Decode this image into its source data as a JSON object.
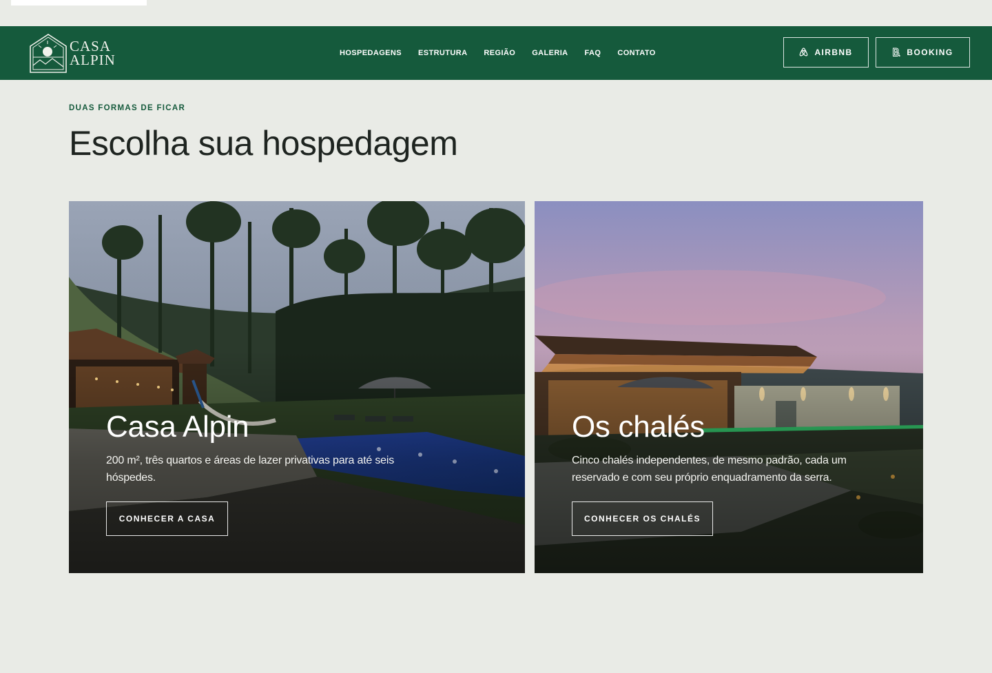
{
  "brand": {
    "name_line1": "CASA",
    "name_line2": "ALPIN",
    "primary_color": "#155a3c",
    "background_color": "#e9ebe6",
    "logo_icon": "mountain-house-logo-icon"
  },
  "nav": {
    "items": [
      {
        "label": "HOSPEDAGENS"
      },
      {
        "label": "ESTRUTURA"
      },
      {
        "label": "REGIÃO"
      },
      {
        "label": "GALERIA"
      },
      {
        "label": "FAQ"
      },
      {
        "label": "CONTATO"
      }
    ]
  },
  "booking": {
    "airbnb": {
      "label": "AIRBNB",
      "icon": "airbnb-icon"
    },
    "booking": {
      "label": "BOOKING",
      "icon": "booking-icon"
    }
  },
  "section": {
    "eyebrow": "DUAS FORMAS DE FICAR",
    "title": "Escolha sua hospedagem"
  },
  "cards": [
    {
      "title": "Casa Alpin",
      "description": "200 m², três quartos e áreas de lazer privativas para até seis hóspedes.",
      "button": "CONHECER A CASA"
    },
    {
      "title": "Os chalés",
      "description": "Cinco chalés independentes, de mesmo padrão, cada um reservado e com seu próprio enquadramento da serra.",
      "button": "CONHECER OS CHALÉS"
    }
  ]
}
